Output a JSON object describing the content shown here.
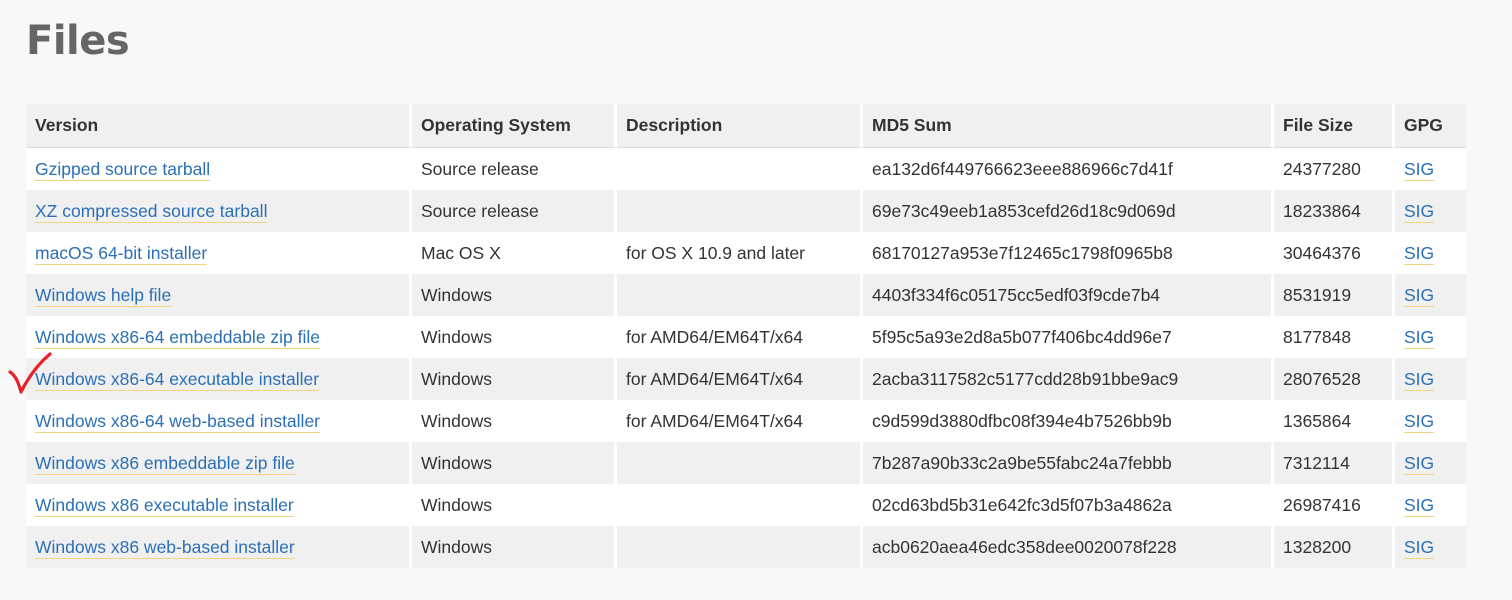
{
  "page": {
    "title": "Files"
  },
  "table": {
    "headers": [
      "Version",
      "Operating System",
      "Description",
      "MD5 Sum",
      "File Size",
      "GPG"
    ],
    "rows": [
      {
        "version": "Gzipped source tarball",
        "os": "Source release",
        "description": "",
        "md5": "ea132d6f449766623eee886966c7d41f",
        "size": "24377280",
        "gpg": "SIG"
      },
      {
        "version": "XZ compressed source tarball",
        "os": "Source release",
        "description": "",
        "md5": "69e73c49eeb1a853cefd26d18c9d069d",
        "size": "18233864",
        "gpg": "SIG"
      },
      {
        "version": "macOS 64-bit installer",
        "os": "Mac OS X",
        "description": "for OS X 10.9 and later",
        "md5": "68170127a953e7f12465c1798f0965b8",
        "size": "30464376",
        "gpg": "SIG"
      },
      {
        "version": "Windows help file",
        "os": "Windows",
        "description": "",
        "md5": "4403f334f6c05175cc5edf03f9cde7b4",
        "size": "8531919",
        "gpg": "SIG"
      },
      {
        "version": "Windows x86-64 embeddable zip file",
        "os": "Windows",
        "description": "for AMD64/EM64T/x64",
        "md5": "5f95c5a93e2d8a5b077f406bc4dd96e7",
        "size": "8177848",
        "gpg": "SIG"
      },
      {
        "version": "Windows x86-64 executable installer",
        "os": "Windows",
        "description": "for AMD64/EM64T/x64",
        "md5": "2acba3117582c5177cdd28b91bbe9ac9",
        "size": "28076528",
        "gpg": "SIG"
      },
      {
        "version": "Windows x86-64 web-based installer",
        "os": "Windows",
        "description": "for AMD64/EM64T/x64",
        "md5": "c9d599d3880dfbc08f394e4b7526bb9b",
        "size": "1365864",
        "gpg": "SIG"
      },
      {
        "version": "Windows x86 embeddable zip file",
        "os": "Windows",
        "description": "",
        "md5": "7b287a90b33c2a9be55fabc24a7febbb",
        "size": "7312114",
        "gpg": "SIG"
      },
      {
        "version": "Windows x86 executable installer",
        "os": "Windows",
        "description": "",
        "md5": "02cd63bd5b31e642fc3d5f07b3a4862a",
        "size": "26987416",
        "gpg": "SIG"
      },
      {
        "version": "Windows x86 web-based installer",
        "os": "Windows",
        "description": "",
        "md5": "acb0620aea46edc358dee0020078f228",
        "size": "1328200",
        "gpg": "SIG"
      }
    ]
  },
  "annotation": {
    "icon": "red-checkmark-icon",
    "marked_row": "Windows x86-64 executable installer",
    "color": "#e8202a"
  },
  "colors": {
    "link": "#2b6fb6",
    "link_underline": "#f2d480",
    "header_bg": "#f0f0f0",
    "stripe_bg": "#f0f0f0",
    "page_bg": "#f8f8f8"
  }
}
